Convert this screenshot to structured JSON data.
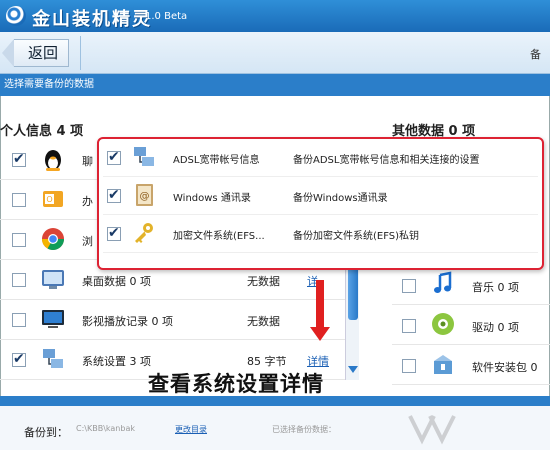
{
  "window": {
    "title": "金山装机精灵",
    "version": "1.0 Beta"
  },
  "toolbar": {
    "back_label": "返回",
    "right_text": "备"
  },
  "instruction": "选择需要备份的数据",
  "left_panel": {
    "title": "个人信息  4  项",
    "rows": [
      {
        "name": "聊",
        "checked": true,
        "icon": "qq-penguin-icon",
        "size": "",
        "detail": ""
      },
      {
        "name": "办",
        "checked": false,
        "icon": "outlook-icon",
        "size": "",
        "detail": ""
      },
      {
        "name": "浏",
        "checked": false,
        "icon": "chrome-icon",
        "size": "",
        "detail": ""
      },
      {
        "name": "桌面数据  0  项",
        "checked": false,
        "icon": "desktop-icon",
        "size": "无数据",
        "detail": "详"
      },
      {
        "name": "影视播放记录  0  项",
        "checked": false,
        "icon": "monitor-icon",
        "size": "无数据",
        "detail": ""
      },
      {
        "name": "系统设置  3  项",
        "checked": true,
        "icon": "network-settings-icon",
        "size": "85 字节",
        "detail": "详情"
      }
    ]
  },
  "right_panel": {
    "title": "其他数据  0  项",
    "rows": [
      {
        "name": "音乐  0  项",
        "checked": false,
        "icon": "music-note-icon"
      },
      {
        "name": "驱动  0  项",
        "checked": false,
        "icon": "driver-gear-icon"
      },
      {
        "name": "软件安装包  0",
        "checked": false,
        "icon": "installer-box-icon"
      }
    ]
  },
  "popup": {
    "rows": [
      {
        "name": "ADSL宽带帐号信息",
        "desc": "备份ADSL宽带帐号信息和相关连接的设置",
        "checked": true,
        "icon": "network-icon"
      },
      {
        "name": "Windows 通讯录",
        "desc": "备份Windows通讯录",
        "checked": true,
        "icon": "address-book-icon"
      },
      {
        "name": "加密文件系统(EFS...",
        "desc": "备份加密文件系统(EFS)私钥",
        "checked": true,
        "icon": "key-icon"
      }
    ]
  },
  "annotation": "查看系统设置详情",
  "footer": {
    "backup_label": "备份到：",
    "backup_path": "C:\\KBB\\kanbak",
    "change_dir": "更改目录",
    "selected_info": "已选择备份数据："
  },
  "colors": {
    "title_blue": "#1a6bb8",
    "band_blue": "#2b7ec9",
    "annotation_red": "#e02020"
  }
}
